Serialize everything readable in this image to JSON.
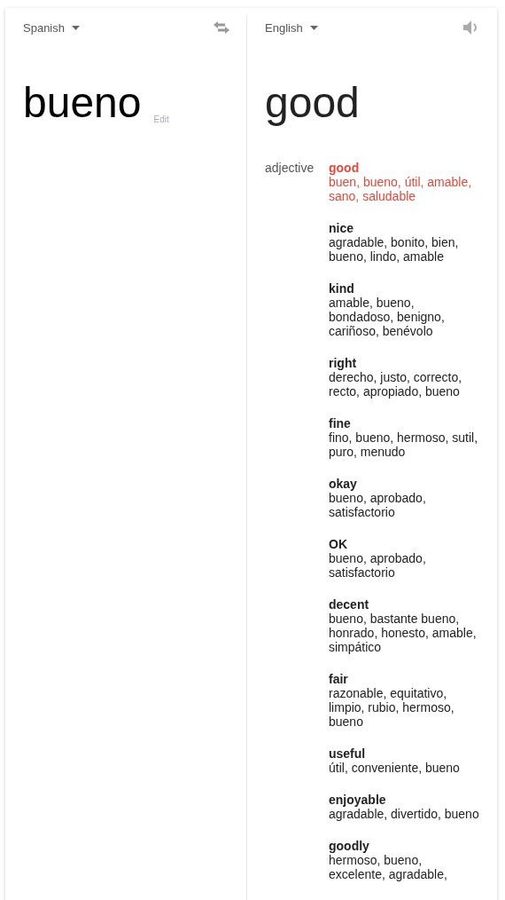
{
  "source": {
    "language": "Spanish",
    "word": "bueno",
    "edit_link": "Edit"
  },
  "target": {
    "language": "English",
    "word": "good"
  },
  "part_of_speech": "adjective",
  "entries": [
    {
      "word": "good",
      "translations": "buen, bueno, útil, amable, sano, saludable",
      "selected": true
    },
    {
      "word": "nice",
      "translations": "agradable, bonito, bien, bueno, lindo, amable",
      "selected": false
    },
    {
      "word": "kind",
      "translations": "amable, bueno, bondadoso, benigno, cariñoso, benévolo",
      "selected": false
    },
    {
      "word": "right",
      "translations": "derecho, justo, correcto, recto, apropiado, bueno",
      "selected": false
    },
    {
      "word": "fine",
      "translations": "fino, bueno, hermoso, sutil, puro, menudo",
      "selected": false
    },
    {
      "word": "okay",
      "translations": "bueno, aprobado, satisfactorio",
      "selected": false
    },
    {
      "word": "OK",
      "translations": "bueno, aprobado, satisfactorio",
      "selected": false
    },
    {
      "word": "decent",
      "translations": "bueno, bastante bueno, honrado, honesto, amable, simpático",
      "selected": false
    },
    {
      "word": "fair",
      "translations": "razonable, equitativo, limpio, rubio, hermoso, bueno",
      "selected": false
    },
    {
      "word": "useful",
      "translations": "útil, conveniente, bueno",
      "selected": false
    },
    {
      "word": "enjoyable",
      "translations": "agradable, divertido, bueno",
      "selected": false
    },
    {
      "word": "goodly",
      "translations": "hermoso, bueno, excelente, agradable,",
      "selected": false
    }
  ]
}
